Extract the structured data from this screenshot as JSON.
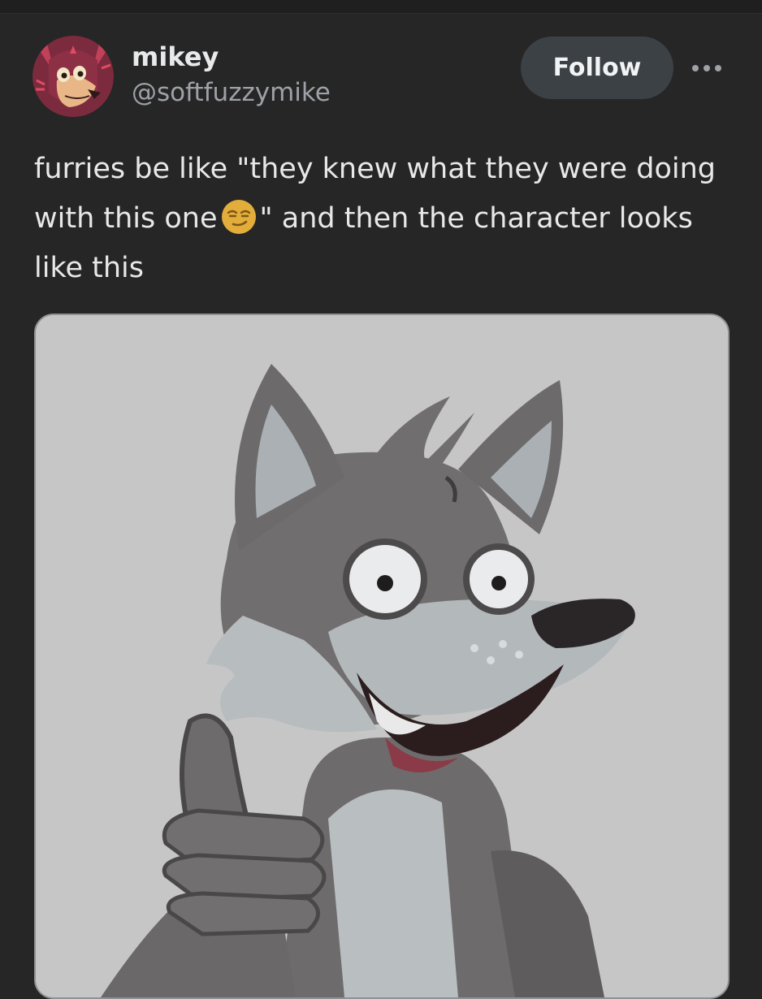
{
  "post": {
    "author": {
      "display_name": "mikey",
      "handle": "@softfuzzymike",
      "avatar_icon": "avatar-red-fox-icon"
    },
    "follow_label": "Follow",
    "more_icon": "more-options-icon",
    "text": {
      "part1": "furries be like \"they knew what they were doing with this one",
      "emoji": "smirking-face-icon",
      "part2": "\" and then the character looks like this"
    },
    "media": {
      "icon": "wolf-thumbs-up-icon"
    }
  },
  "colors": {
    "background": "#262626",
    "follow_button": "#3c4146",
    "text": "#e7e9ea",
    "secondary_text": "#9ea1a6",
    "emoji": "#e3ad3b"
  }
}
